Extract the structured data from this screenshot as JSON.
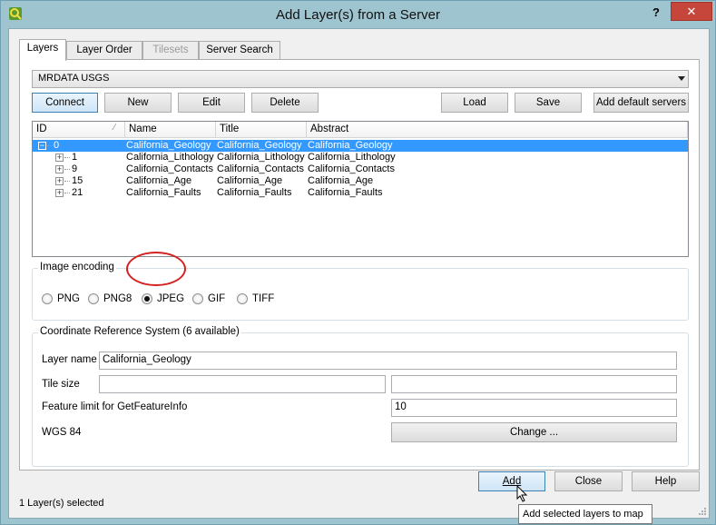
{
  "window": {
    "title": "Add Layer(s) from a Server",
    "help_label": "?",
    "close_label": "✕"
  },
  "tabs": [
    {
      "label": "Layers",
      "active": true
    },
    {
      "label": "Layer Order"
    },
    {
      "label": "Tilesets",
      "disabled": true
    },
    {
      "label": "Server Search"
    }
  ],
  "server": {
    "selected": "MRDATA USGS"
  },
  "server_buttons": {
    "connect": "Connect",
    "new": "New",
    "edit": "Edit",
    "delete": "Delete",
    "load": "Load",
    "save": "Save",
    "add_default": "Add default servers"
  },
  "layers_table": {
    "columns": [
      "ID",
      "Name",
      "Title",
      "Abstract"
    ],
    "sort_indicator": "⁄",
    "rows": [
      {
        "expander": "−",
        "id": "0",
        "name": "California_Geology",
        "title": "California_Geology",
        "abstract": "California_Geology",
        "selected": true
      },
      {
        "expander": "+",
        "id": "1",
        "name": "California_Lithology",
        "title": "California_Lithology",
        "abstract": "California_Lithology"
      },
      {
        "expander": "+",
        "id": "9",
        "name": "California_Contacts",
        "title": "California_Contacts",
        "abstract": "California_Contacts"
      },
      {
        "expander": "+",
        "id": "15",
        "name": "California_Age",
        "title": "California_Age",
        "abstract": "California_Age"
      },
      {
        "expander": "+",
        "id": "21",
        "name": "California_Faults",
        "title": "California_Faults",
        "abstract": "California_Faults"
      }
    ]
  },
  "image_encoding": {
    "title": "Image encoding",
    "options": [
      "PNG",
      "PNG8",
      "JPEG",
      "GIF",
      "TIFF"
    ],
    "selected": "JPEG"
  },
  "crs": {
    "title": "Coordinate Reference System (6 available)",
    "layer_name_label": "Layer name",
    "layer_name_value": "California_Geology",
    "tile_size_label": "Tile size",
    "tile_width": "",
    "tile_height": "",
    "feature_limit_label": "Feature limit for GetFeatureInfo",
    "feature_limit_value": "10",
    "crs_name": "WGS 84",
    "change_label": "Change ..."
  },
  "dialog_buttons": {
    "add": "Add",
    "close": "Close",
    "help": "Help"
  },
  "status": "1 Layer(s) selected",
  "tooltip": "Add selected layers to map",
  "colors": {
    "selection": "#3399ff",
    "highlight_ring": "#d42020",
    "window_frame": "#9ec4d0",
    "close_button": "#c7463c"
  }
}
